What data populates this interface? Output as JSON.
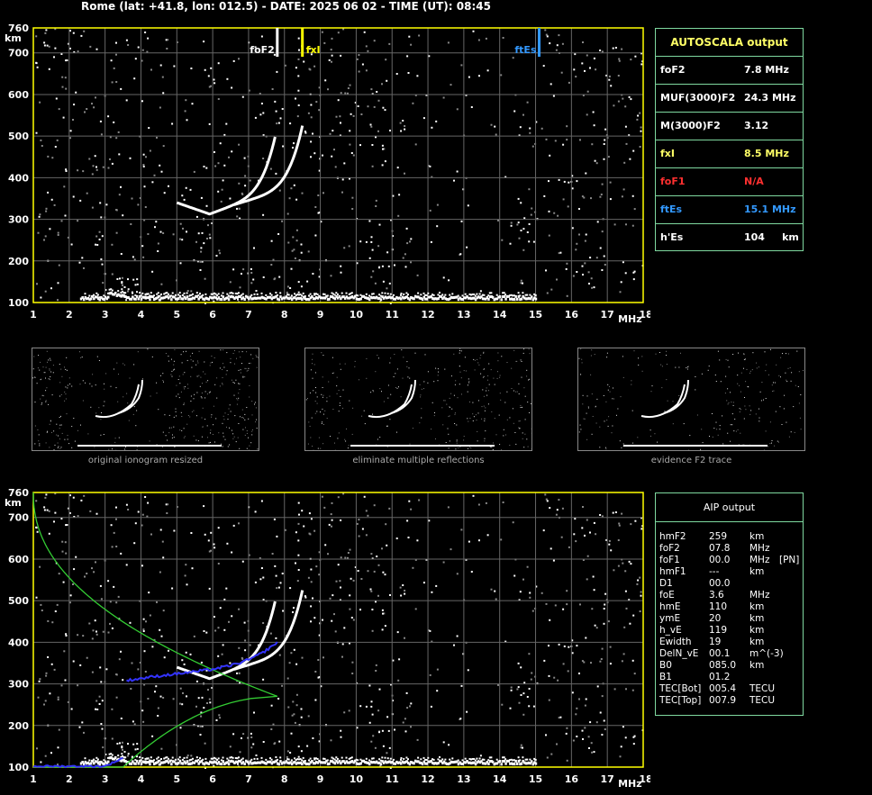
{
  "header": "Rome (lat: +41.8, lon: 012.5) - DATE: 2025 06 02 - TIME (UT): 08:45",
  "colors": {
    "frame": "#ffff00",
    "grid": "#666666",
    "accent_panel": "#7fd9a0",
    "fxI": "#ffff00",
    "fof1": "#ff3030",
    "ftes": "#3399ff",
    "green_curve": "#33cc33",
    "blue_curve": "#3333ff"
  },
  "ionogram": {
    "y_labels": [
      "760",
      "700",
      "600",
      "500",
      "400",
      "300",
      "200",
      "100"
    ],
    "y_unit": "km",
    "x_labels": [
      "1",
      "2",
      "3",
      "4",
      "5",
      "6",
      "7",
      "8",
      "9",
      "10",
      "11",
      "12",
      "13",
      "14",
      "15",
      "16",
      "17",
      "18"
    ],
    "x_unit": "MHz",
    "markers": [
      {
        "label": "foF2",
        "freq": 7.8,
        "color": "#ffffff"
      },
      {
        "label": "fxI",
        "freq": 8.5,
        "color": "#ffff00"
      },
      {
        "label": "ftEs",
        "freq": 15.1,
        "color": "#3399ff"
      }
    ]
  },
  "autoscala": {
    "title": "AUTOSCALA output",
    "rows": [
      {
        "label": "foF2",
        "value": "7.8 MHz",
        "color": "#ffffff"
      },
      {
        "label": "MUF(3000)F2",
        "value": "24.3 MHz",
        "color": "#ffffff"
      },
      {
        "label": "M(3000)F2",
        "value": "3.12",
        "color": "#ffffff"
      },
      {
        "label": "fxI",
        "value": "8.5 MHz",
        "color": "#ffff66"
      },
      {
        "label": "foF1",
        "value": "N/A",
        "color": "#ff3030"
      },
      {
        "label": "ftEs",
        "value": "15.1 MHz",
        "color": "#3399ff"
      },
      {
        "label": "h'Es",
        "value": "104     km",
        "color": "#ffffff"
      }
    ]
  },
  "thumbnails": [
    {
      "caption": "original ionogram resized"
    },
    {
      "caption": "eliminate multiple reflections"
    },
    {
      "caption": "evidence F2 trace"
    }
  ],
  "aip": {
    "title": "AIP output",
    "rows": [
      {
        "name": "hmF2",
        "value": "259",
        "unit": "km",
        "extra": ""
      },
      {
        "name": "foF2",
        "value": "07.8",
        "unit": "MHz",
        "extra": ""
      },
      {
        "name": "foF1",
        "value": "00.0",
        "unit": "MHz",
        "extra": "[PN]"
      },
      {
        "name": "hmF1",
        "value": "---",
        "unit": "km",
        "extra": ""
      },
      {
        "name": "D1",
        "value": "00.0",
        "unit": "",
        "extra": ""
      },
      {
        "name": "foE",
        "value": "3.6",
        "unit": "MHz",
        "extra": ""
      },
      {
        "name": "hmE",
        "value": "110",
        "unit": "km",
        "extra": ""
      },
      {
        "name": "ymE",
        "value": "20",
        "unit": "km",
        "extra": ""
      },
      {
        "name": "h_vE",
        "value": "119",
        "unit": "km",
        "extra": ""
      },
      {
        "name": "Ewidth",
        "value": "19",
        "unit": "km",
        "extra": ""
      },
      {
        "name": "DelN_vE",
        "value": "00.1",
        "unit": "m^(-3)",
        "extra": ""
      },
      {
        "name": "B0",
        "value": "085.0",
        "unit": "km",
        "extra": ""
      },
      {
        "name": "B1",
        "value": "01.2",
        "unit": "",
        "extra": ""
      },
      {
        "name": "TEC[Bot]",
        "value": "005.4",
        "unit": "TECU",
        "extra": ""
      },
      {
        "name": "TEC[Top]",
        "value": "007.9",
        "unit": "TECU",
        "extra": ""
      }
    ]
  }
}
